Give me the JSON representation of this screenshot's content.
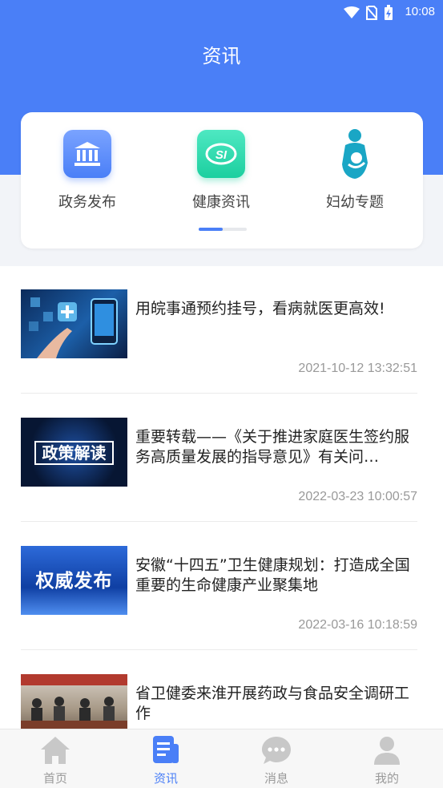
{
  "status_bar": {
    "time": "10:08",
    "icons": [
      "wifi-icon",
      "no-sim-icon",
      "battery-charging-icon"
    ]
  },
  "header": {
    "title": "资讯"
  },
  "categories": [
    {
      "label": "政务发布",
      "icon": "government-building-icon",
      "color": "#5b8cf9"
    },
    {
      "label": "健康资讯",
      "icon": "social-security-icon",
      "color": "#25d3a6"
    },
    {
      "label": "妇幼专题",
      "icon": "mother-baby-icon",
      "color": "#1aa6c5"
    }
  ],
  "news": [
    {
      "title": "用皖事通预约挂号，看病就医更高效!",
      "time": "2021-10-12 13:32:51",
      "thumb_text": ""
    },
    {
      "title": "重要转载——《关于推进家庭医生签约服务高质量发展的指导意见》有关问…",
      "time": "2022-03-23 10:00:57",
      "thumb_text": "政策解读"
    },
    {
      "title": "安徽“十四五”卫生健康规划：打造成全国重要的生命健康产业聚集地",
      "time": "2022-03-16 10:18:59",
      "thumb_text": "权威发布"
    },
    {
      "title": "省卫健委来淮开展药政与食品安全调研工作",
      "time": "",
      "thumb_text": ""
    }
  ],
  "tabbar": {
    "active_color": "#4a7ff7",
    "items": [
      {
        "label": "首页",
        "icon": "home-icon"
      },
      {
        "label": "资讯",
        "icon": "news-icon"
      },
      {
        "label": "消息",
        "icon": "message-icon"
      },
      {
        "label": "我的",
        "icon": "profile-icon"
      }
    ]
  }
}
